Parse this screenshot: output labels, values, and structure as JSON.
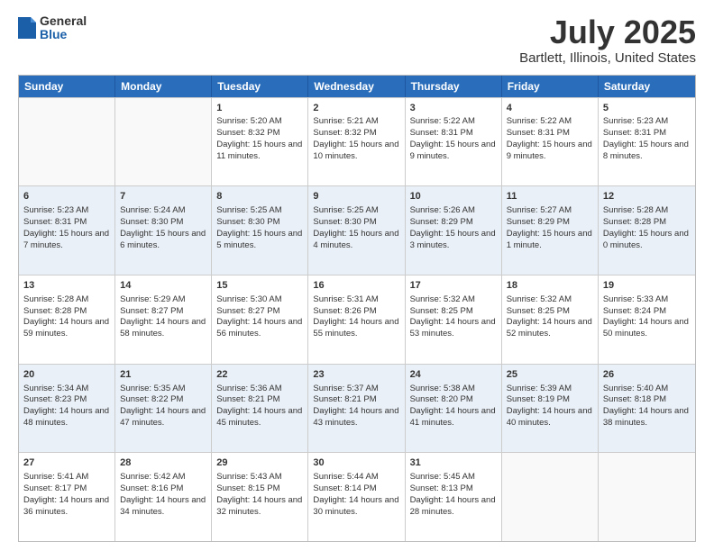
{
  "header": {
    "logo_general": "General",
    "logo_blue": "Blue",
    "title": "July 2025",
    "subtitle": "Bartlett, Illinois, United States"
  },
  "calendar": {
    "headers": [
      "Sunday",
      "Monday",
      "Tuesday",
      "Wednesday",
      "Thursday",
      "Friday",
      "Saturday"
    ],
    "rows": [
      [
        {
          "day": "",
          "info": ""
        },
        {
          "day": "",
          "info": ""
        },
        {
          "day": "1",
          "info": "Sunrise: 5:20 AM\nSunset: 8:32 PM\nDaylight: 15 hours and 11 minutes."
        },
        {
          "day": "2",
          "info": "Sunrise: 5:21 AM\nSunset: 8:32 PM\nDaylight: 15 hours and 10 minutes."
        },
        {
          "day": "3",
          "info": "Sunrise: 5:22 AM\nSunset: 8:31 PM\nDaylight: 15 hours and 9 minutes."
        },
        {
          "day": "4",
          "info": "Sunrise: 5:22 AM\nSunset: 8:31 PM\nDaylight: 15 hours and 9 minutes."
        },
        {
          "day": "5",
          "info": "Sunrise: 5:23 AM\nSunset: 8:31 PM\nDaylight: 15 hours and 8 minutes."
        }
      ],
      [
        {
          "day": "6",
          "info": "Sunrise: 5:23 AM\nSunset: 8:31 PM\nDaylight: 15 hours and 7 minutes."
        },
        {
          "day": "7",
          "info": "Sunrise: 5:24 AM\nSunset: 8:30 PM\nDaylight: 15 hours and 6 minutes."
        },
        {
          "day": "8",
          "info": "Sunrise: 5:25 AM\nSunset: 8:30 PM\nDaylight: 15 hours and 5 minutes."
        },
        {
          "day": "9",
          "info": "Sunrise: 5:25 AM\nSunset: 8:30 PM\nDaylight: 15 hours and 4 minutes."
        },
        {
          "day": "10",
          "info": "Sunrise: 5:26 AM\nSunset: 8:29 PM\nDaylight: 15 hours and 3 minutes."
        },
        {
          "day": "11",
          "info": "Sunrise: 5:27 AM\nSunset: 8:29 PM\nDaylight: 15 hours and 1 minute."
        },
        {
          "day": "12",
          "info": "Sunrise: 5:28 AM\nSunset: 8:28 PM\nDaylight: 15 hours and 0 minutes."
        }
      ],
      [
        {
          "day": "13",
          "info": "Sunrise: 5:28 AM\nSunset: 8:28 PM\nDaylight: 14 hours and 59 minutes."
        },
        {
          "day": "14",
          "info": "Sunrise: 5:29 AM\nSunset: 8:27 PM\nDaylight: 14 hours and 58 minutes."
        },
        {
          "day": "15",
          "info": "Sunrise: 5:30 AM\nSunset: 8:27 PM\nDaylight: 14 hours and 56 minutes."
        },
        {
          "day": "16",
          "info": "Sunrise: 5:31 AM\nSunset: 8:26 PM\nDaylight: 14 hours and 55 minutes."
        },
        {
          "day": "17",
          "info": "Sunrise: 5:32 AM\nSunset: 8:25 PM\nDaylight: 14 hours and 53 minutes."
        },
        {
          "day": "18",
          "info": "Sunrise: 5:32 AM\nSunset: 8:25 PM\nDaylight: 14 hours and 52 minutes."
        },
        {
          "day": "19",
          "info": "Sunrise: 5:33 AM\nSunset: 8:24 PM\nDaylight: 14 hours and 50 minutes."
        }
      ],
      [
        {
          "day": "20",
          "info": "Sunrise: 5:34 AM\nSunset: 8:23 PM\nDaylight: 14 hours and 48 minutes."
        },
        {
          "day": "21",
          "info": "Sunrise: 5:35 AM\nSunset: 8:22 PM\nDaylight: 14 hours and 47 minutes."
        },
        {
          "day": "22",
          "info": "Sunrise: 5:36 AM\nSunset: 8:21 PM\nDaylight: 14 hours and 45 minutes."
        },
        {
          "day": "23",
          "info": "Sunrise: 5:37 AM\nSunset: 8:21 PM\nDaylight: 14 hours and 43 minutes."
        },
        {
          "day": "24",
          "info": "Sunrise: 5:38 AM\nSunset: 8:20 PM\nDaylight: 14 hours and 41 minutes."
        },
        {
          "day": "25",
          "info": "Sunrise: 5:39 AM\nSunset: 8:19 PM\nDaylight: 14 hours and 40 minutes."
        },
        {
          "day": "26",
          "info": "Sunrise: 5:40 AM\nSunset: 8:18 PM\nDaylight: 14 hours and 38 minutes."
        }
      ],
      [
        {
          "day": "27",
          "info": "Sunrise: 5:41 AM\nSunset: 8:17 PM\nDaylight: 14 hours and 36 minutes."
        },
        {
          "day": "28",
          "info": "Sunrise: 5:42 AM\nSunset: 8:16 PM\nDaylight: 14 hours and 34 minutes."
        },
        {
          "day": "29",
          "info": "Sunrise: 5:43 AM\nSunset: 8:15 PM\nDaylight: 14 hours and 32 minutes."
        },
        {
          "day": "30",
          "info": "Sunrise: 5:44 AM\nSunset: 8:14 PM\nDaylight: 14 hours and 30 minutes."
        },
        {
          "day": "31",
          "info": "Sunrise: 5:45 AM\nSunset: 8:13 PM\nDaylight: 14 hours and 28 minutes."
        },
        {
          "day": "",
          "info": ""
        },
        {
          "day": "",
          "info": ""
        }
      ]
    ]
  }
}
